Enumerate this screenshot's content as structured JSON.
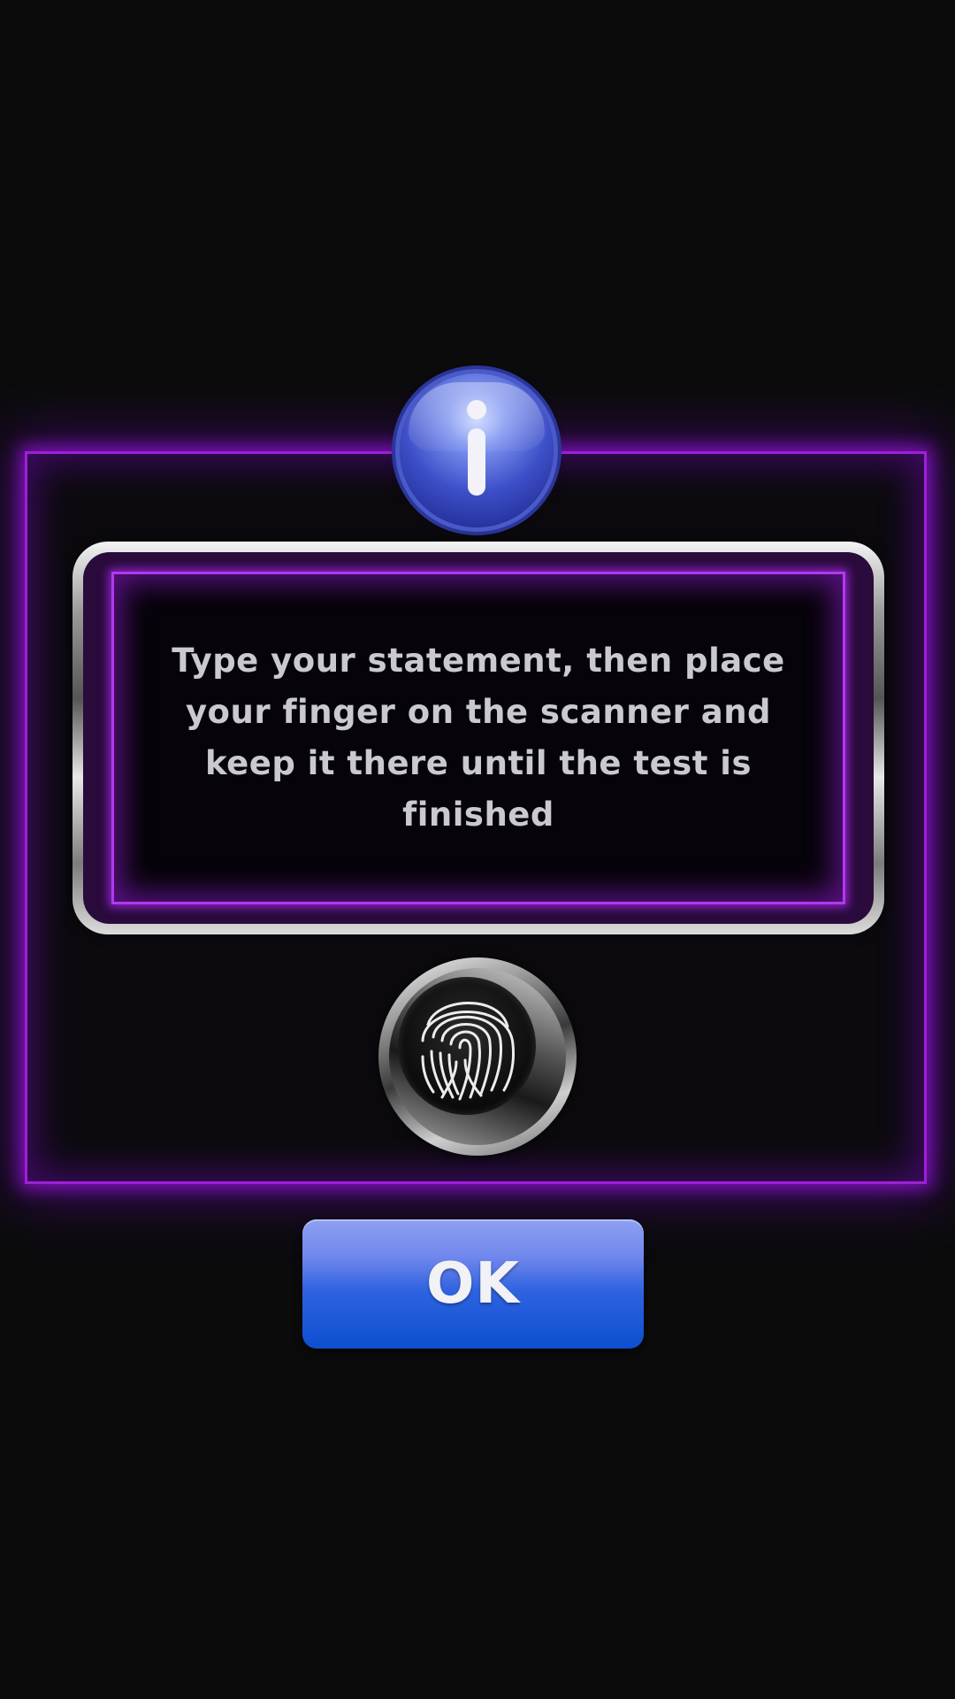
{
  "dialog": {
    "message": "Type your statement, then place your finger on the scanner and keep it there until the test is finished",
    "info_icon": "info-icon",
    "scanner_icon": "fingerprint-icon",
    "ok_label": "OK"
  },
  "colors": {
    "background": "#0b0b0c",
    "neon_purple": "#a01ed8",
    "text": "#c9c9cf",
    "ok_button": "#2f63e0",
    "info_badge": "#3d4fc8"
  }
}
